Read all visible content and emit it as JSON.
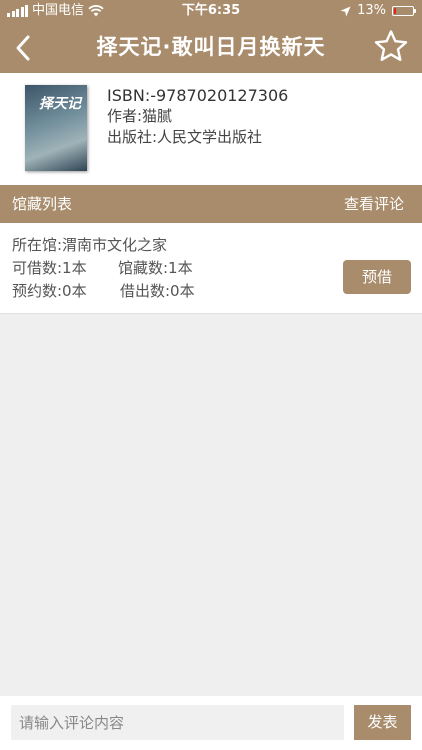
{
  "status_bar": {
    "carrier": "中国电信",
    "time": "下午6:35",
    "battery_percent": "13%",
    "battery_level": 0.13,
    "battery_color": "#e02020"
  },
  "nav": {
    "title": "择天记·敢叫日月换新天",
    "back_icon": "chevron-left-icon",
    "favorite_icon": "star-outline-icon"
  },
  "book": {
    "cover_text": "择天记",
    "isbn": "ISBN:-9787020127306",
    "author": "作者:猫腻",
    "publisher": "出版社:人民文学出版社"
  },
  "holdings_section": {
    "title": "馆藏列表",
    "view_comments": "查看评论"
  },
  "holdings": [
    {
      "library": "所在馆:渭南市文化之家",
      "available": "可借数:1本",
      "total": "馆藏数:1本",
      "reserved": "预约数:0本",
      "lent": "借出数:0本",
      "reserve_label": "预借"
    }
  ],
  "comment": {
    "placeholder": "请输入评论内容",
    "value": "",
    "publish_label": "发表"
  },
  "colors": {
    "accent": "#a88c6c",
    "background": "#efefef"
  }
}
